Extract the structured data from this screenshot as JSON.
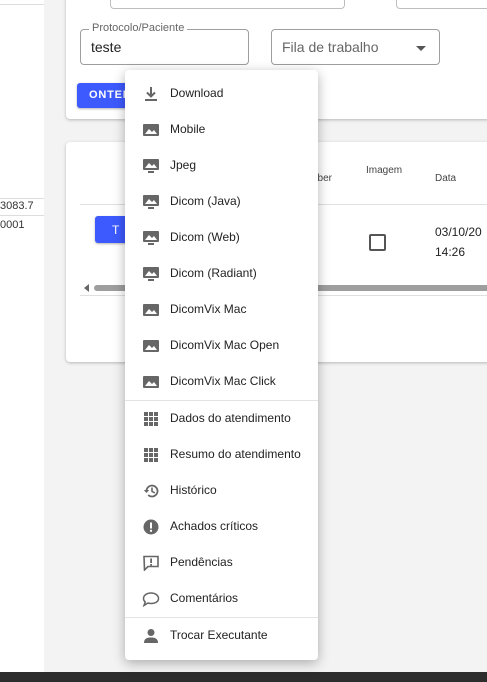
{
  "left_panel": {
    "value_1": "3083.7",
    "value_2": "0001"
  },
  "filters": {
    "protocol_label": "Protocolo/Paciente",
    "protocol_value": "teste",
    "queue_placeholder": "Fila de trabalho",
    "get_button": "ONTEM"
  },
  "table": {
    "col_partial": "aber",
    "col_image": "Imagem",
    "col_date": "Data",
    "row_button": "T",
    "row_date_line1": "03/10/20",
    "row_date_line2": "14:26"
  },
  "menu": {
    "items": [
      {
        "label": "Download",
        "icon": "download-icon"
      },
      {
        "label": "Mobile",
        "icon": "image-icon"
      },
      {
        "label": "Jpeg",
        "icon": "monitor-image-icon"
      },
      {
        "label": "Dicom (Java)",
        "icon": "monitor-image-icon"
      },
      {
        "label": "Dicom (Web)",
        "icon": "monitor-image-icon"
      },
      {
        "label": "Dicom (Radiant)",
        "icon": "monitor-image-icon"
      },
      {
        "label": "DicomVix Mac",
        "icon": "image-icon"
      },
      {
        "label": "DicomVix Mac Open",
        "icon": "image-icon"
      },
      {
        "label": "DicomVix Mac Click",
        "icon": "image-icon"
      },
      {
        "label": "Dados do atendimento",
        "icon": "grid-icon"
      },
      {
        "label": "Resumo do atendimento",
        "icon": "grid-icon"
      },
      {
        "label": "Histórico",
        "icon": "history-icon"
      },
      {
        "label": "Achados críticos",
        "icon": "alert-circle-icon"
      },
      {
        "label": "Pendências",
        "icon": "feedback-icon"
      },
      {
        "label": "Comentários",
        "icon": "comment-icon"
      },
      {
        "label": "Trocar Executante",
        "icon": "person-icon"
      }
    ]
  },
  "colors": {
    "primary": "#3d5afe",
    "icon": "#666666"
  }
}
